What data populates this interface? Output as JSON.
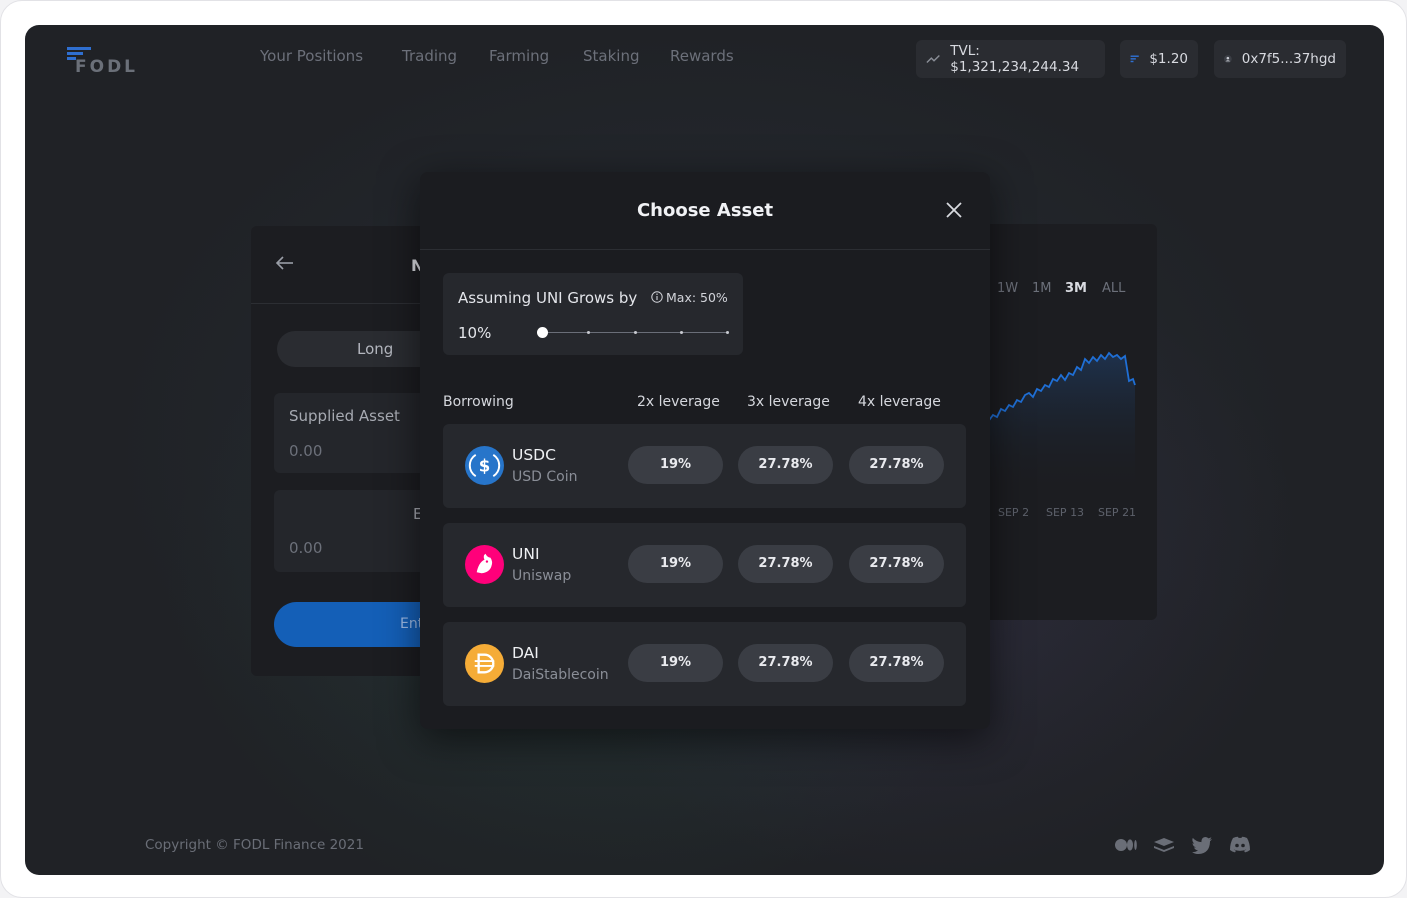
{
  "header": {
    "nav": [
      "Your Positions",
      "Trading",
      "Farming",
      "Staking",
      "Rewards"
    ],
    "tvl": "TVL: $1,321,234,244.34",
    "price": "$1.20",
    "wallet": "0x7f5...37hgd",
    "icons": [
      "fodl-logo",
      "trend-icon",
      "fodl-token-icon",
      "avatar-icon"
    ]
  },
  "background_form": {
    "title_partial": "N",
    "toggle_label": "Long",
    "supplied_label": "Supplied Asset",
    "supplied_value": "0.00",
    "second_label_partial": "E",
    "second_value": "0.00",
    "enter_button_partial": "Ent"
  },
  "background_chart": {
    "ranges": [
      "1W",
      "1M",
      "3M",
      "ALL"
    ],
    "active_range": "3M",
    "x_ticks": [
      "SEP 2",
      "SEP 13",
      "SEP 21"
    ],
    "line_color": "#1f6fd6"
  },
  "modal": {
    "title": "Choose Asset",
    "grow": {
      "label": "Assuming UNI Grows by",
      "max": "Max: 50%",
      "value": "10%",
      "slider_fraction": 0
    },
    "columns": [
      "Borrowing",
      "2x leverage",
      "3x leverage",
      "4x leverage"
    ],
    "assets": [
      {
        "symbol": "USDC",
        "name": "USD Coin",
        "icon": "usdc-icon",
        "color": "#2775ca",
        "values": [
          "19%",
          "27.78%",
          "27.78%"
        ]
      },
      {
        "symbol": "UNI",
        "name": "Uniswap",
        "icon": "uniswap-icon",
        "color": "#ff007a",
        "values": [
          "19%",
          "27.78%",
          "27.78%"
        ]
      },
      {
        "symbol": "DAI",
        "name": "DaiStablecoin",
        "icon": "dai-icon",
        "color": "#f5ac37",
        "values": [
          "19%",
          "27.78%",
          "27.78%"
        ]
      }
    ]
  },
  "footer": {
    "copyright": "Copyright © FODL Finance 2021",
    "social_icons": [
      "medium-icon",
      "docs-icon",
      "twitter-icon",
      "discord-icon"
    ]
  }
}
